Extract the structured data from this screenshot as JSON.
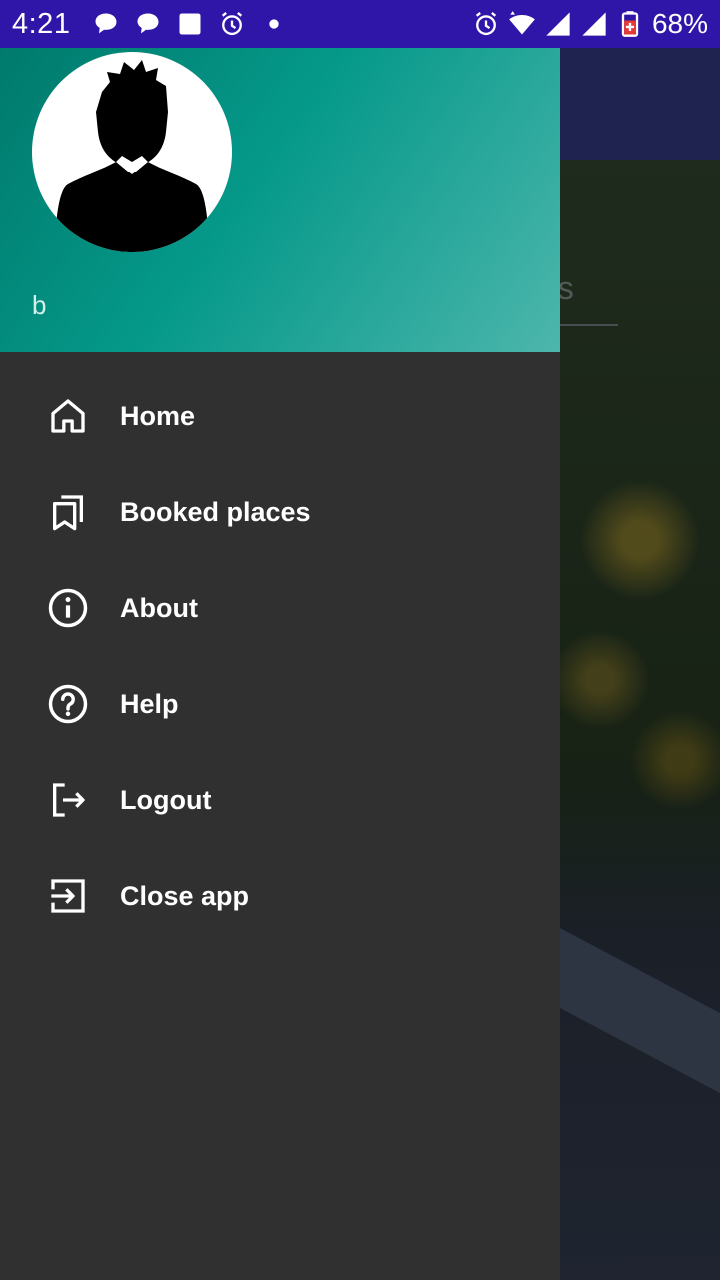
{
  "status_bar": {
    "time": "4:21",
    "battery": "68%",
    "icons_left": [
      "chat-bubble-icon",
      "chat-bubble-icon",
      "square-notification-icon",
      "alarm-icon",
      "dot-icon"
    ],
    "icons_right": [
      "alarm-icon",
      "wifi-icon",
      "signal-icon",
      "signal-icon",
      "battery-icon"
    ]
  },
  "background": {
    "tab_text_fragment": "ns"
  },
  "drawer": {
    "header": {
      "username": "b",
      "avatar_icon": "person-silhouette-icon"
    },
    "menu": [
      {
        "label": "Home",
        "icon": "home-icon"
      },
      {
        "label": "Booked places",
        "icon": "bookmarks-icon"
      },
      {
        "label": "About",
        "icon": "info-icon"
      },
      {
        "label": "Help",
        "icon": "help-icon"
      },
      {
        "label": "Logout",
        "icon": "logout-icon"
      },
      {
        "label": "Close app",
        "icon": "exit-app-icon"
      }
    ]
  },
  "colors": {
    "status_bar": "#2f16a8",
    "drawer_bg": "#303030",
    "header_start": "#007a6c",
    "header_end": "#4db6ac"
  }
}
